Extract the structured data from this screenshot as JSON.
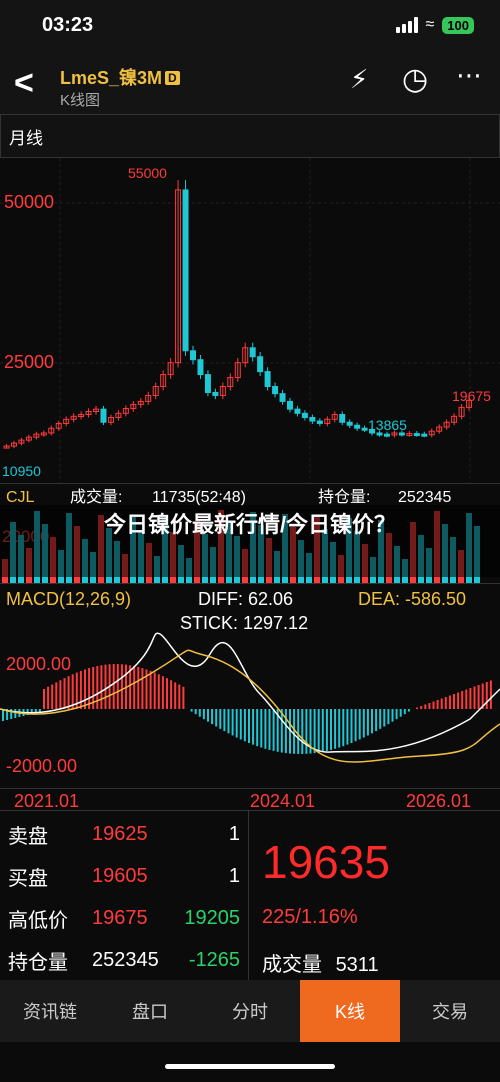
{
  "status": {
    "time": "03:23",
    "battery": "100"
  },
  "header": {
    "title": "LmeS_镍3M",
    "badge": "D",
    "subtitle": "K线图"
  },
  "period": "月线",
  "kline": {
    "price_labels": [
      "50000",
      "25000"
    ],
    "high_label": "55000",
    "low_label": "10950",
    "last_label": "19675",
    "min_label": "13865"
  },
  "volume": {
    "name": "CJL",
    "vol_label": "成交量:",
    "vol_value": "11735(52:48)",
    "oi_label": "持仓量:",
    "oi_value": "252345",
    "scale": "20000"
  },
  "macd": {
    "name": "MACD(12,26,9)",
    "diff": "DIFF: 62.06",
    "dea": "DEA: -586.50",
    "stick": "STICK: 1297.12",
    "top": "2000.00",
    "bottom": "-2000.00"
  },
  "xaxis": [
    "2021.01",
    "2024.01",
    "2026.01"
  ],
  "quote": {
    "sell_label": "卖盘",
    "sell_price": "19625",
    "sell_qty": "1",
    "buy_label": "买盘",
    "buy_price": "19605",
    "buy_qty": "1",
    "hl_label": "高低价",
    "high": "19675",
    "low": "19205",
    "oi_label": "持仓量",
    "oi": "252345",
    "oi_change": "-1265",
    "last": "19635",
    "change": "225/1.16%",
    "vol_label": "成交量",
    "vol": "5311"
  },
  "overlay_text": "今日镍价最新行情/今日镍价？",
  "tabs": [
    "资讯链",
    "盘口",
    "分时",
    "K线",
    "交易"
  ],
  "active_tab": 3,
  "colors": {
    "up": "#ff3b3b",
    "down": "#1ec8d4",
    "accent": "#ef6a1f",
    "title": "#f0c040"
  },
  "chart_data": {
    "type": "candlestick",
    "title": "",
    "ylim": [
      10950,
      55000
    ],
    "series": [
      {
        "values": [
          12000,
          12500,
          13000,
          13500,
          14000,
          14200,
          15000,
          15800,
          16500,
          17000,
          17300,
          17800,
          18200,
          16000,
          16800,
          17500,
          18300,
          19000,
          19500,
          20500,
          22000,
          24000,
          26000,
          55000,
          28000,
          26500,
          24000,
          21000,
          20500,
          22000,
          23500,
          26000,
          28500,
          27000,
          24500,
          22000,
          20800,
          19500,
          18200,
          17500,
          16800,
          16200,
          15800,
          16500,
          17300,
          16000,
          15500,
          15000,
          14800,
          14200,
          14000,
          13865,
          14200,
          14000,
          14100,
          14000,
          13900,
          14500,
          15200,
          16000,
          17000,
          18500,
          19675
        ]
      }
    ]
  }
}
